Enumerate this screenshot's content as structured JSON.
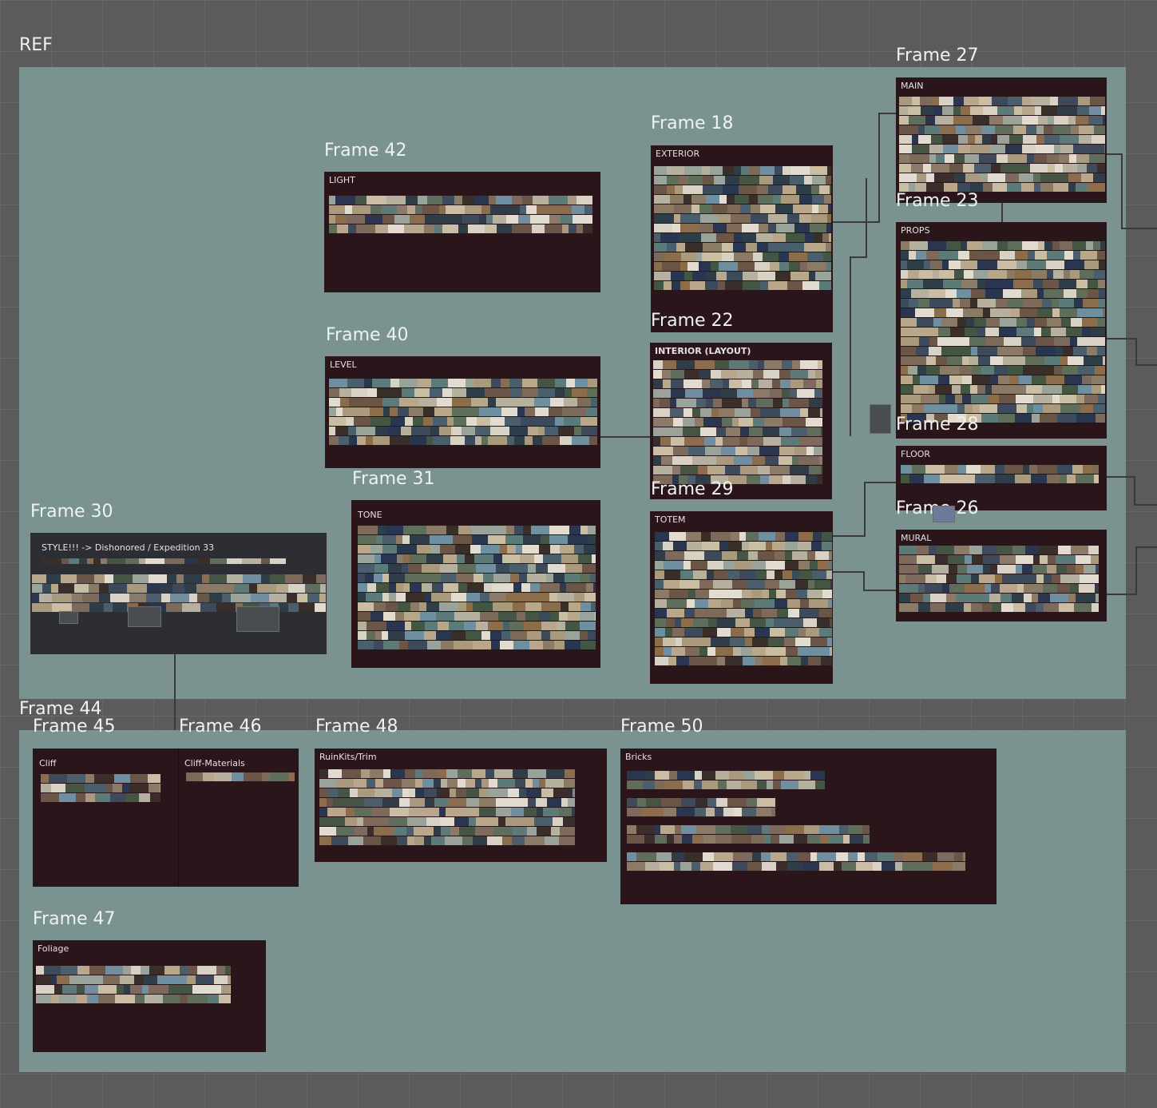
{
  "page_frame": {
    "label": "REF"
  },
  "colors": {
    "canvas": "#5b5b5b",
    "section": "#7a9290",
    "board": "#2a151a",
    "board_alt": "#2d2e33",
    "label": "#eef2f2"
  },
  "frames": {
    "f27": {
      "label": "Frame 27",
      "board_title": "MAIN"
    },
    "f23": {
      "label": "Frame 23",
      "board_title": "PROPS"
    },
    "f28": {
      "label": "Frame 28",
      "board_title": "FLOOR"
    },
    "f26": {
      "label": "Frame 26",
      "board_title": "MURAL"
    },
    "f18": {
      "label": "Frame 18",
      "board_title": "EXTERIOR"
    },
    "f22": {
      "label": "Frame 22",
      "board_title": "INTERIOR  (LAYOUT)"
    },
    "f29": {
      "label": "Frame 29",
      "board_title": "TOTEM"
    },
    "f42": {
      "label": "Frame 42",
      "board_title": "LIGHT"
    },
    "f40": {
      "label": "Frame 40",
      "board_title": "LEVEL"
    },
    "f31": {
      "label": "Frame 31",
      "board_title": "TONE"
    },
    "f30": {
      "label": "Frame 30",
      "board_title": "STYLE!!! -> Dishonored / Expedition 33"
    },
    "f44": {
      "label": "Frame 44"
    },
    "f45": {
      "label": "Frame 45",
      "board_title": "Cliff"
    },
    "f46": {
      "label": "Frame 46",
      "board_title": "Cliff-Materials"
    },
    "f48": {
      "label": "Frame 48",
      "board_title": "RuinKits/Trim"
    },
    "f50": {
      "label": "Frame 50",
      "board_title": "Bricks"
    },
    "f47": {
      "label": "Frame 47",
      "board_title": "Foliage"
    }
  }
}
